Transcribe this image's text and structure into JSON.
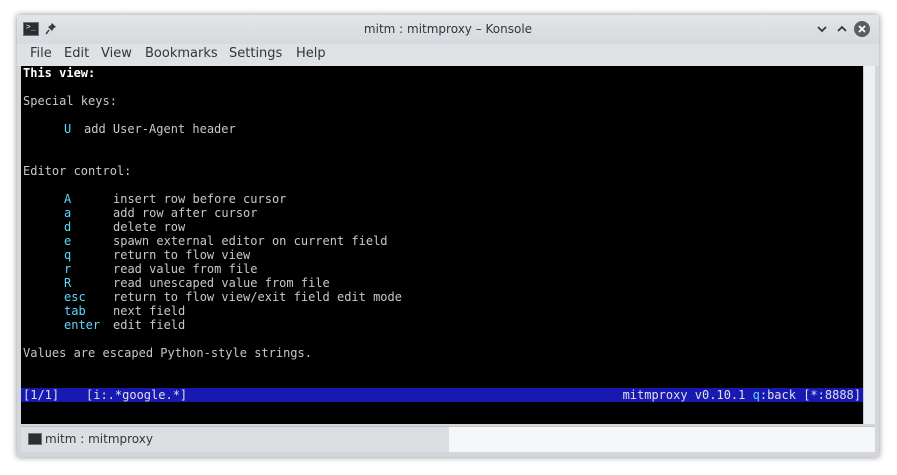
{
  "window": {
    "title": "mitm : mitmproxy – Konsole"
  },
  "menu": {
    "file": "File",
    "edit": "Edit",
    "view": "View",
    "bookmarks": "Bookmarks",
    "settings": "Settings",
    "help": "Help"
  },
  "terminal": {
    "this_view": "This view:",
    "special_keys_heading": "Special keys:",
    "special_keys": [
      {
        "key": "U",
        "desc": "add User-Agent header"
      }
    ],
    "editor_heading": "Editor control:",
    "editor_keys": [
      {
        "key": "A",
        "desc": "insert row before cursor"
      },
      {
        "key": "a",
        "desc": "add row after cursor"
      },
      {
        "key": "d",
        "desc": "delete row"
      },
      {
        "key": "e",
        "desc": "spawn external editor on current field"
      },
      {
        "key": "q",
        "desc": "return to flow view"
      },
      {
        "key": "r",
        "desc": "read value from file"
      },
      {
        "key": "R",
        "desc": "read unescaped value from file"
      },
      {
        "key": "esc",
        "desc": "return to flow view/exit field edit mode"
      },
      {
        "key": "tab",
        "desc": "next field"
      },
      {
        "key": "enter",
        "desc": "edit field"
      }
    ],
    "footer": "Values are escaped Python-style strings."
  },
  "status": {
    "page": "[1/1]",
    "filter": "[i:.*google.*]",
    "version": "mitmproxy v0.10.1 ",
    "q_key": "q",
    "back": ":back",
    "port": " [*:8888]"
  },
  "tab": {
    "label": "mitm : mitmproxy"
  },
  "colors": {
    "terminal_bg": "#000000",
    "status_bg": "#1818b2",
    "key_color": "#5fd7ff"
  }
}
